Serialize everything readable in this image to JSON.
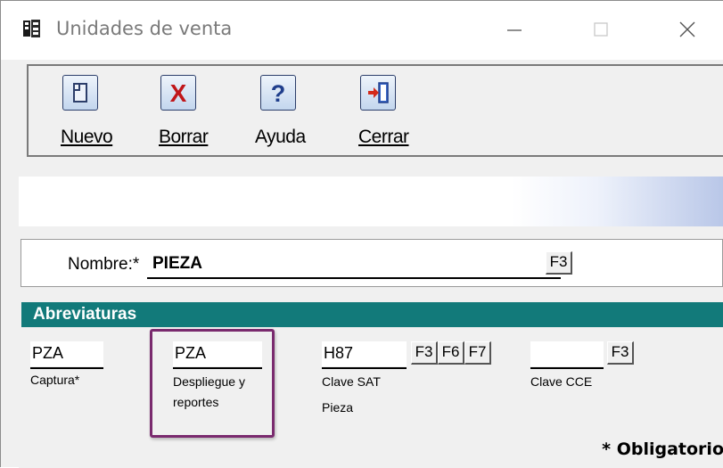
{
  "window": {
    "title": "Unidades de venta"
  },
  "toolbar": {
    "nuevo": {
      "label": "Nuevo",
      "icon": "new-document-icon"
    },
    "borrar": {
      "label": "Borrar",
      "icon": "delete-x-icon"
    },
    "ayuda": {
      "label": "Ayuda",
      "icon": "help-question-icon"
    },
    "cerrar": {
      "label": "Cerrar",
      "icon": "exit-door-icon"
    }
  },
  "nombre": {
    "label": "Nombre:*",
    "value": "PIEZA",
    "f3": "F3"
  },
  "abreviaturas": {
    "header": "Abreviaturas",
    "captura": {
      "value": "PZA",
      "label": "Captura*"
    },
    "despliegue": {
      "value": "PZA",
      "label_line1": "Despliegue y",
      "label_line2": "reportes"
    },
    "clave_sat": {
      "value": "H87",
      "label": "Clave SAT",
      "description": "Pieza",
      "f3": "F3",
      "f6": "F6",
      "f7": "F7"
    },
    "clave_cce": {
      "value": "",
      "label": "Clave CCE",
      "f3": "F3"
    }
  },
  "footer": {
    "required_note": "* Obligatorio"
  },
  "colors": {
    "section_header": "#127a7a",
    "highlight": "#7a2a6e"
  }
}
